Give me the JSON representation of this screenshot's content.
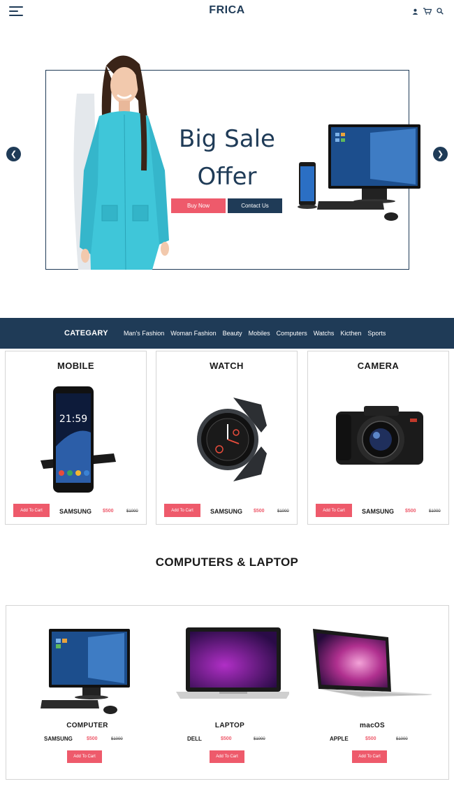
{
  "header": {
    "logo": "FRICA",
    "icons": [
      "user-icon",
      "cart-icon",
      "search-icon"
    ]
  },
  "hero": {
    "title_line1": "Big Sale",
    "title_line2": "Offer",
    "buy_label": "Buy Now",
    "contact_label": "Contact Us"
  },
  "category": {
    "title": "CATEGARY",
    "links": [
      "Man's Fashion",
      "Woman Fashion",
      "Beauty",
      "Mobiles",
      "Computers",
      "Watchs",
      "Kicthen",
      "Sports"
    ]
  },
  "products": [
    {
      "title": "MOBILE",
      "add_label": "Add To Cart",
      "brand": "SAMSUNG",
      "price": "$500",
      "old_price": "$1000"
    },
    {
      "title": "WATCH",
      "add_label": "Add To Cart",
      "brand": "SAMSUNG",
      "price": "$500",
      "old_price": "$1000"
    },
    {
      "title": "CAMERA",
      "add_label": "Add To Cart",
      "brand": "SAMSUNG",
      "price": "$500",
      "old_price": "$1000"
    }
  ],
  "computers": {
    "title": "COMPUTERS & LAPTOP",
    "items": [
      {
        "name": "COMPUTER",
        "brand": "SAMSUNG",
        "price": "$500",
        "old_price": "$1000",
        "add_label": "Add To Cart"
      },
      {
        "name": "LAPTOP",
        "brand": "DELL",
        "price": "$500",
        "old_price": "$1000",
        "add_label": "Add To Cart"
      },
      {
        "name": "macOS",
        "brand": "APPLE",
        "price": "$500",
        "old_price": "$1000",
        "add_label": "Add To Cart"
      }
    ]
  },
  "colors": {
    "navy": "#1f3b57",
    "accent": "#ee5a6b"
  }
}
